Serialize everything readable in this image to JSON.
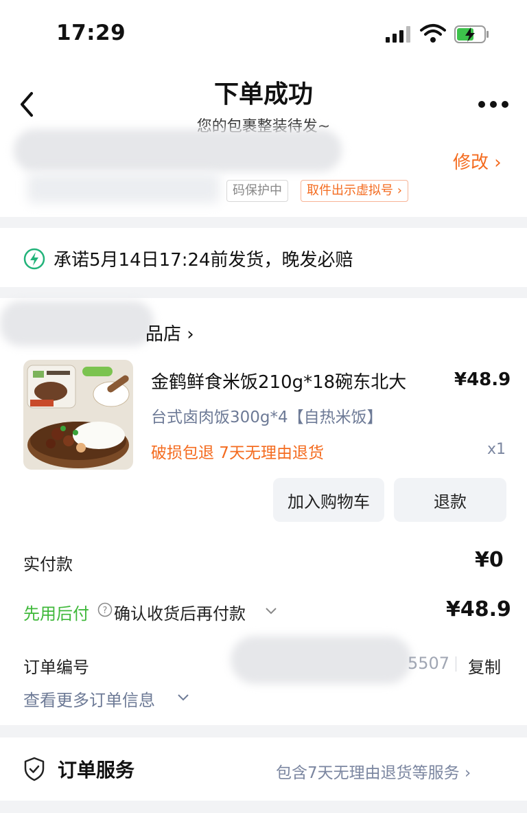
{
  "status_bar": {
    "time": "17:29"
  },
  "header": {
    "title": "下单成功",
    "subtitle": "您的包裹整装待发~"
  },
  "address": {
    "modify_label": "修改 ›",
    "privacy_tag": "码保护中",
    "virtual_tag": "取件出示虚拟号 ›"
  },
  "promise": {
    "text": "承诺5月14日17:24前发货，晚发必赔"
  },
  "shop": {
    "name_suffix": "品店 ›"
  },
  "product": {
    "title": "金鹤鲜食米饭210g*18碗东北大",
    "price": "¥48.9",
    "spec": "台式卤肉饭300g*4【自热米饭】",
    "tags": "破损包退  7天无理由退货",
    "qty": "x1"
  },
  "actions": {
    "add_to_cart": "加入购物车",
    "refund": "退款"
  },
  "payment": {
    "paid_label": "实付款",
    "paid_value": "¥0",
    "later_label": "先用后付",
    "later_desc": "确认收货后再付款",
    "later_price": "¥48.9"
  },
  "order": {
    "number_label": "订单编号",
    "number_tail": "5507",
    "copy_label": "复制",
    "more_info": "查看更多订单信息"
  },
  "service": {
    "label": "订单服务",
    "desc": "包含7天无理由退货等服务 ›"
  },
  "colors": {
    "accent_orange": "#f46b1f",
    "green": "#3fb83a",
    "muted_blue": "#6d7a96"
  }
}
